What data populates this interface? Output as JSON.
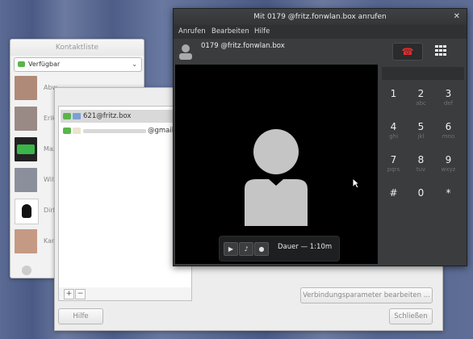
{
  "contact_list": {
    "title": "Kontaktliste",
    "status": "Verfügbar",
    "contacts": [
      {
        "name": "Abw",
        "avatar_color": "#b08a78"
      },
      {
        "name": "Erik",
        "avatar_color": "#9a8a86"
      },
      {
        "name": "Max",
        "avatar_color": "#39b54a"
      },
      {
        "name": "Will",
        "avatar_color": "#8b8f9c"
      },
      {
        "name": "Dirk",
        "avatar_color": "#d8d8d8"
      },
      {
        "name": "Kar",
        "avatar_color": "#c49a84"
      }
    ]
  },
  "accounts_dialog": {
    "accounts": [
      {
        "label": "621@fritz.box",
        "selected": true
      },
      {
        "label": "@gmail.c",
        "selected": false
      }
    ],
    "add_label": "+",
    "remove_label": "−",
    "help_button": "Hilfe",
    "edit_button": "Verbindungsparameter bearbeiten ...",
    "close_button": "Schließen"
  },
  "call_window": {
    "title": "Mit 0179          @fritz.fonwlan.box anrufen",
    "close_glyph": "✕",
    "menu": [
      "Anrufen",
      "Bearbeiten",
      "Hilfe"
    ],
    "address": "0179          @fritz.fonwlan.box",
    "hangup_icon": "☎",
    "duration": "Dauer — 1:10m",
    "keys": [
      {
        "digit": "1",
        "letters": ""
      },
      {
        "digit": "2",
        "letters": "abc"
      },
      {
        "digit": "3",
        "letters": "def"
      },
      {
        "digit": "4",
        "letters": "ghi"
      },
      {
        "digit": "5",
        "letters": "jkl"
      },
      {
        "digit": "6",
        "letters": "mno"
      },
      {
        "digit": "7",
        "letters": "pqrs"
      },
      {
        "digit": "8",
        "letters": "tuv"
      },
      {
        "digit": "9",
        "letters": "wxyz"
      },
      {
        "digit": "#",
        "letters": ""
      },
      {
        "digit": "0",
        "letters": ""
      },
      {
        "digit": "*",
        "letters": ""
      }
    ],
    "colors": {
      "hangup": "#e03030",
      "available": "#5bb54a"
    }
  }
}
